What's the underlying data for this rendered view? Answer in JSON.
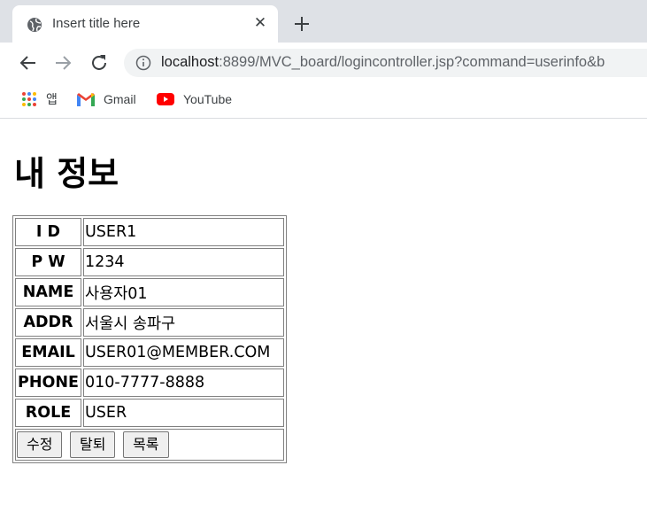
{
  "browser": {
    "tab": {
      "title": "Insert title here",
      "favicon": "globe-icon",
      "close_glyph": "✕"
    },
    "new_tab_icon": "plus-icon",
    "nav": {
      "back_icon": "arrow-left-icon",
      "forward_icon": "arrow-right-icon",
      "reload_icon": "reload-icon"
    },
    "url": {
      "host": "localhost",
      "rest": ":8899/MVC_board/logincontroller.jsp?command=userinfo&b"
    },
    "bookmarks": [
      {
        "label": "앱",
        "icon": "apps-grid-icon"
      },
      {
        "label": "Gmail",
        "icon": "gmail-icon"
      },
      {
        "label": "YouTube",
        "icon": "youtube-icon"
      }
    ]
  },
  "page": {
    "heading": "내 정보",
    "rows": [
      {
        "label": "I D",
        "value": "USER1"
      },
      {
        "label": "P W",
        "value": "1234"
      },
      {
        "label": "NAME",
        "value": "사용자01"
      },
      {
        "label": "ADDR",
        "value": "서울시 송파구"
      },
      {
        "label": "EMAIL",
        "value": "USER01@MEMBER.COM"
      },
      {
        "label": "PHONE",
        "value": "010-7777-8888"
      },
      {
        "label": "ROLE",
        "value": "USER"
      }
    ],
    "buttons": {
      "edit": "수정",
      "withdraw": "탈퇴",
      "list": "목록"
    }
  },
  "colors": {
    "tabstrip_bg": "#dee1e6",
    "omnibox_bg": "#f1f3f4",
    "table_border": "#808080",
    "button_bg": "#efefef"
  }
}
